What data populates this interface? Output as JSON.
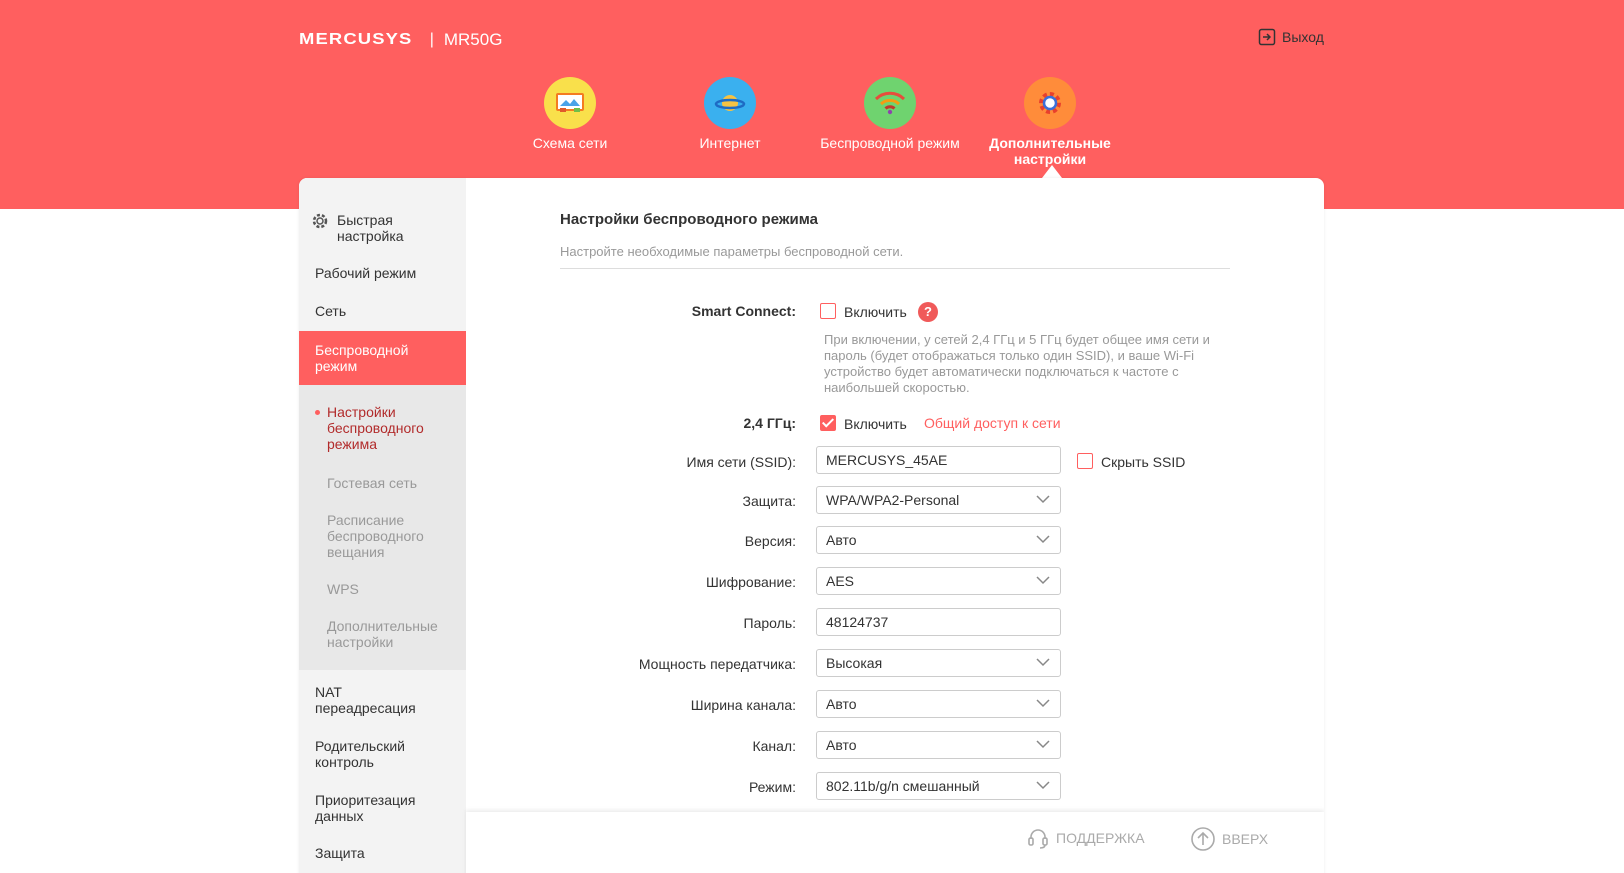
{
  "header": {
    "brand": "MERCUSYS",
    "separator": "|",
    "model": "MR50G",
    "logout_label": "Выход"
  },
  "topnav": [
    {
      "label": "Схема сети",
      "icon": "network-map-icon",
      "color": "#f9e04b"
    },
    {
      "label": "Интернет",
      "icon": "planet-icon",
      "color": "#3ab0ef"
    },
    {
      "label": "Беспроводной режим",
      "icon": "wifi-icon",
      "color": "#6fd36f"
    },
    {
      "label": "Дополнительные настройки",
      "icon": "gear-icon",
      "color": "#ff8c3a",
      "active": true
    }
  ],
  "sidebar": {
    "items": [
      {
        "label": "Быстрая настройка",
        "icon": "gear-icon"
      },
      {
        "label": "Рабочий режим"
      },
      {
        "label": "Сеть"
      },
      {
        "label": "Беспроводной режим",
        "active": true
      },
      {
        "label": "NAT переадресация"
      },
      {
        "label": "Родительский контроль"
      },
      {
        "label": "Приоритезация данных"
      },
      {
        "label": "Защита"
      }
    ],
    "subitems": [
      {
        "label": "Настройки беспроводного режима",
        "active": true
      },
      {
        "label": "Гостевая сеть"
      },
      {
        "label": "Расписание беспроводного вещания"
      },
      {
        "label": "WPS"
      },
      {
        "label": "Дополнительные настройки"
      }
    ]
  },
  "main": {
    "title": "Настройки беспроводного режима",
    "subtitle": "Настройте необходимые параметры беспроводной сети.",
    "smart_connect": {
      "label": "Smart Connect:",
      "checkbox_label": "Включить",
      "checked": false,
      "help": "?",
      "note": "При включении, у сетей 2,4 ГГц и 5 ГГц будет общее имя сети и пароль (будет отображаться только один SSID), и ваше Wi-Fi устройство будет автоматически подключаться к частоте с наибольшей скоростью."
    },
    "band24": {
      "label": "2,4 ГГц:",
      "checkbox_label": "Включить",
      "checked": true,
      "share_link": "Общий доступ к сети"
    },
    "ssid": {
      "label": "Имя сети (SSID):",
      "value": "MERCUSYS_45AE",
      "hide_label": "Скрыть SSID",
      "hide_checked": false
    },
    "security": {
      "label": "Защита:",
      "value": "WPA/WPA2-Personal"
    },
    "version": {
      "label": "Версия:",
      "value": "Авто"
    },
    "encryption": {
      "label": "Шифрование:",
      "value": "AES"
    },
    "password": {
      "label": "Пароль:",
      "value": "48124737"
    },
    "tx_power": {
      "label": "Мощность передатчика:",
      "value": "Высокая"
    },
    "channel_width": {
      "label": "Ширина канала:",
      "value": "Авто"
    },
    "channel": {
      "label": "Канал:",
      "value": "Авто"
    },
    "mode": {
      "label": "Режим:",
      "value": "802.11b/g/n смешанный"
    }
  },
  "footer": {
    "support_label": "ПОДДЕРЖКА",
    "top_label": "ВВЕРХ"
  },
  "colors": {
    "brand_red": "#ff5f5f",
    "sidebar_bg": "#f3f3f3"
  }
}
